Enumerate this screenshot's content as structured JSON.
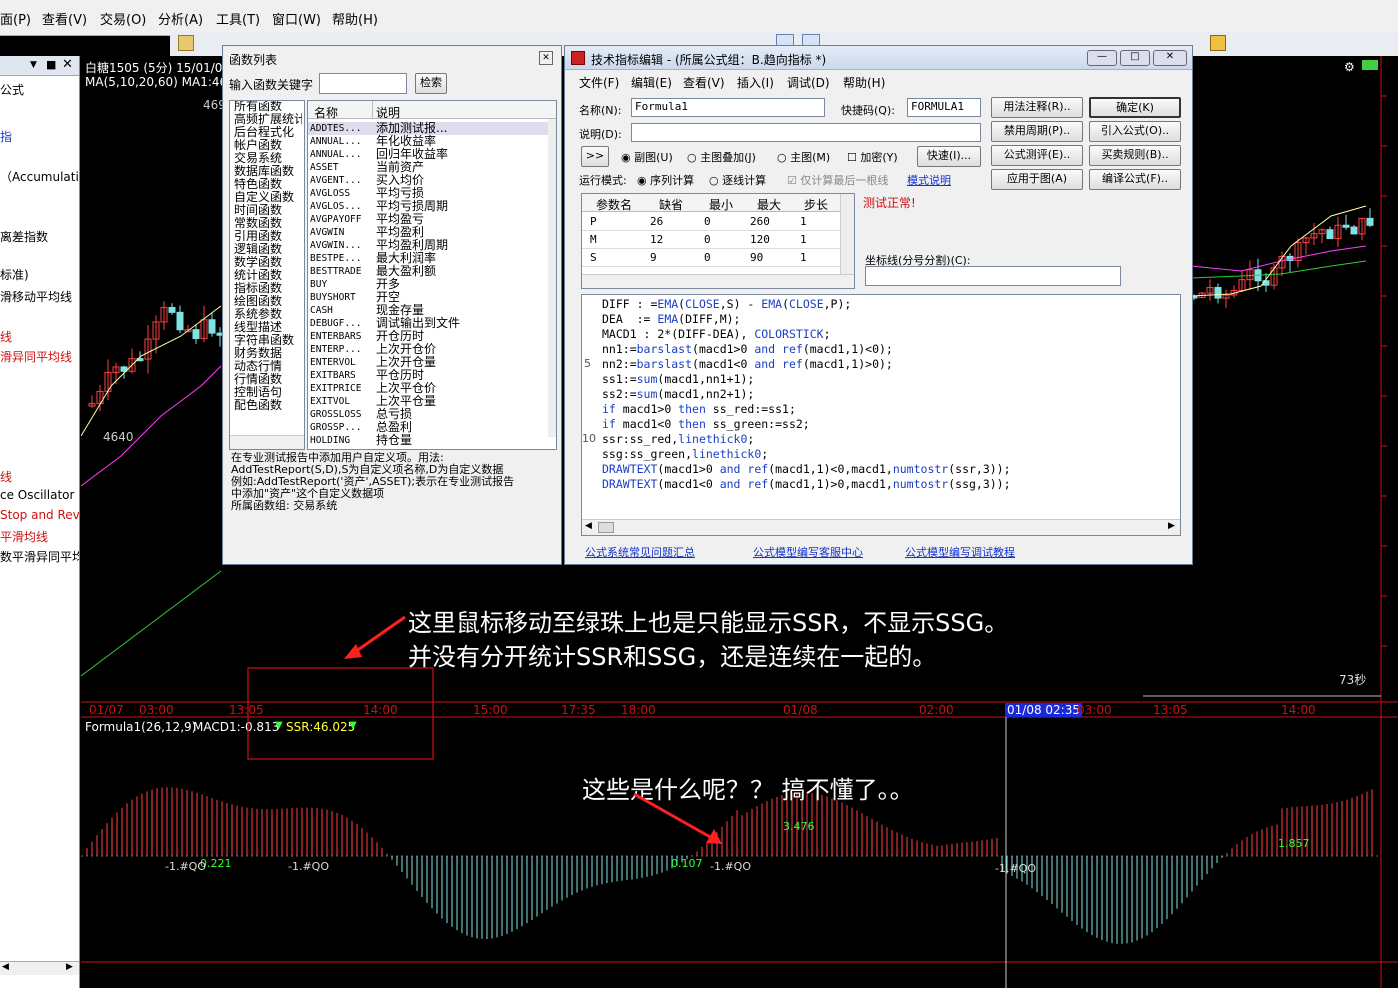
{
  "menubar": {
    "items": [
      "面(P)",
      "查看(V)",
      "交易(O)",
      "分析(A)",
      "工具(T)",
      "窗口(W)",
      "帮助(H)"
    ]
  },
  "left_panel": {
    "header": "公式",
    "items": [
      {
        "text": "指",
        "color": "#1a3fc0"
      },
      {
        "text": "（Accumulatic",
        "color": "#000000"
      },
      {
        "text": "离差指数",
        "color": "#000000"
      },
      {
        "text": "标准)",
        "color": "#000000"
      },
      {
        "text": "滑移动平均线",
        "color": "#000000"
      },
      {
        "text": "线",
        "color": "#d01010"
      },
      {
        "text": "滑异同平均线",
        "color": "#d01010"
      },
      {
        "text": "线",
        "color": "#d01010"
      },
      {
        "text": "ce Oscillator",
        "color": "#000000"
      },
      {
        "text": "Stop and Rev",
        "color": "#d01010"
      },
      {
        "text": "平滑均线",
        "color": "#d01010"
      },
      {
        "text": "数平滑异同平均",
        "color": "#000000"
      }
    ]
  },
  "main_chart": {
    "symbol_line": "白糖1505 (5分) 15/01/0",
    "ma_line": "MA(5,10,20,60)  MA1:46",
    "price_label_top": "469",
    "price_label_low": "4640",
    "seconds_label": "73秒",
    "time_labels": [
      "01/07",
      "03:00",
      "13:05",
      "14:00",
      "15:00",
      "17:35",
      "18:00",
      "01/08",
      "02:00",
      "01/08 02:35",
      "03:00",
      "13:05",
      "14:00"
    ],
    "time_label_highlight": "01/08 02:35"
  },
  "sub_chart": {
    "title": "Formula1(26,12,9)",
    "macd_label": "MACD1:-0.813",
    "ssr_label": "SSR:46.025",
    "value_labels": [
      "0.221",
      "0.107",
      "3.476",
      "1.857"
    ],
    "ssr_marker_labels": [
      "-1.#QO",
      "-1.#QO",
      "-1.#QO",
      "-1.#QO"
    ],
    "colors": {
      "up": "#ff4040",
      "down": "#7fe3e3",
      "text_green": "#33ff33",
      "ssr_yellow": "#ffff33"
    }
  },
  "func_list_dialog": {
    "title": "函数列表",
    "search_label": "输入函数关键字",
    "search_value": "",
    "search_button": "检索",
    "categories": [
      "所有函数",
      "高频扩展统计",
      "后台程式化",
      "帐户函数",
      "交易系统",
      "数据库函数",
      "特色函数",
      "自定义函数",
      "时间函数",
      "常数函数",
      "引用函数",
      "逻辑函数",
      "数学函数",
      "统计函数",
      "指标函数",
      "绘图函数",
      "系统参数",
      "线型描述",
      "字符串函数",
      "财务数据",
      "动态行情",
      "行情函数",
      "控制语句",
      "配色函数"
    ],
    "col_name": "名称",
    "col_desc": "说明",
    "functions": [
      [
        "ADDTES...",
        "添加测试报..."
      ],
      [
        "ANNUAL...",
        "年化收益率"
      ],
      [
        "ANNUAL...",
        "回归年收益率"
      ],
      [
        "ASSET",
        "当前资产"
      ],
      [
        "AVGENT...",
        "买入均价"
      ],
      [
        "AVGLOSS",
        "平均亏损"
      ],
      [
        "AVGLOS...",
        "平均亏损周期"
      ],
      [
        "AVGPAYOFF",
        "平均盈亏"
      ],
      [
        "AVGWIN",
        "平均盈利"
      ],
      [
        "AVGWIN...",
        "平均盈利周期"
      ],
      [
        "BESTPE...",
        "最大利润率"
      ],
      [
        "BESTTRADE",
        "最大盈利额"
      ],
      [
        "BUY",
        "开多"
      ],
      [
        "BUYSHORT",
        "开空"
      ],
      [
        "CASH",
        "现金存量"
      ],
      [
        "DEBUGF...",
        "调试输出到文件"
      ],
      [
        "ENTERBARS",
        "开仓历时"
      ],
      [
        "ENTERP...",
        "上次开仓价"
      ],
      [
        "ENTERVOL",
        "上次开仓量"
      ],
      [
        "EXITBARS",
        "平仓历时"
      ],
      [
        "EXITPRICE",
        "上次平仓价"
      ],
      [
        "EXITVOL",
        "上次平仓量"
      ],
      [
        "GROSSLOSS",
        "总亏损"
      ],
      [
        "GROSSP...",
        "总盈利"
      ],
      [
        "HOLDING",
        "持仓量"
      ]
    ],
    "description_lines": [
      "在专业测试报告中添加用户自定义项。用法:",
      "AddTestReport(S,D),S为自定义项名称,D为自定义数据",
      "例如:AddTestReport('资产',ASSET);表示在专业测试报告",
      "中添加\"资产\"这个自定义数据项",
      "所属函数组: 交易系统"
    ]
  },
  "editor_dialog": {
    "title": "技术指标编辑 - (所属公式组：B.趋向指标 *)",
    "menu": [
      "文件(F)",
      "编辑(E)",
      "查看(V)",
      "插入(I)",
      "调试(D)",
      "帮助(H)"
    ],
    "name_label": "名称(N):",
    "name_value": "Formula1",
    "shortcut_label": "快捷码(Q):",
    "shortcut_value": "FORMULA1",
    "desc_label": "说明(D):",
    "desc_value": "",
    "expand_button": ">>",
    "radio_subchart": "副图(U)",
    "radio_overlay": "主图叠加(J)",
    "radio_main": "主图(M)",
    "check_encrypt": "加密(Y)",
    "quick_button": "快速(I)...",
    "mode_label": "运行模式:",
    "mode_sequence": "序列计算",
    "mode_tick": "逐线计算",
    "mode_last_only": "仅计算最后一根线",
    "mode_help_link": "模式说明",
    "right_buttons": [
      [
        "用法注释(R)..",
        "确定(K)"
      ],
      [
        "禁用周期(P)..",
        "引入公式(O).."
      ],
      [
        "公式测评(E)..",
        "买卖规则(B).."
      ],
      [
        "应用于图(A)",
        "编译公式(F).."
      ]
    ],
    "param_headers": [
      "参数名",
      "缺省",
      "最小",
      "最大",
      "步长"
    ],
    "params": [
      [
        "P",
        "26",
        "0",
        "260",
        "1"
      ],
      [
        "M",
        "12",
        "0",
        "120",
        "1"
      ],
      [
        "S",
        "9",
        "0",
        "90",
        "1"
      ]
    ],
    "test_status": "测试正常!",
    "axis_label": "坐标线(分号分割)(C):",
    "axis_value": "",
    "code_lines": [
      "DIFF : =EMA(CLOSE,S) - EMA(CLOSE,P);",
      "DEA  := EMA(DIFF,M);",
      "MACD1 : 2*(DIFF-DEA), COLORSTICK;",
      "nn1:=barslast(macd1>0 and ref(macd1,1)<0);",
      "nn2:=barslast(macd1<0 and ref(macd1,1)>0);",
      "ss1:=sum(macd1,nn1+1);",
      "ss2:=sum(macd1,nn2+1);",
      "if macd1>0 then ss_red:=ss1;",
      "if macd1<0 then ss_green:=ss2;",
      "ssr:ss_red,linethick0;",
      "ssg:ss_green,linethick0;",
      "DRAWTEXT(macd1>0 and ref(macd1,1)<0,macd1,numtostr(ssr,3));",
      "DRAWTEXT(macd1<0 and ref(macd1,1)>0,macd1,numtostr(ssg,3));"
    ],
    "line_numbers": [
      "5",
      "10"
    ],
    "footer_links": [
      "公式系统常见问题汇总",
      "公式模型编写客服中心",
      "公式模型编写调试教程"
    ]
  },
  "annotations": {
    "note1_line1": "这里鼠标移动至绿珠上也是只能显示SSR，不显示SSG。",
    "note1_line2": "并没有分开统计SSR和SSG，还是连续在一起的。",
    "note2": "这些是什么呢？？ 搞不懂了。。",
    "arrow_color": "#ff2020"
  }
}
